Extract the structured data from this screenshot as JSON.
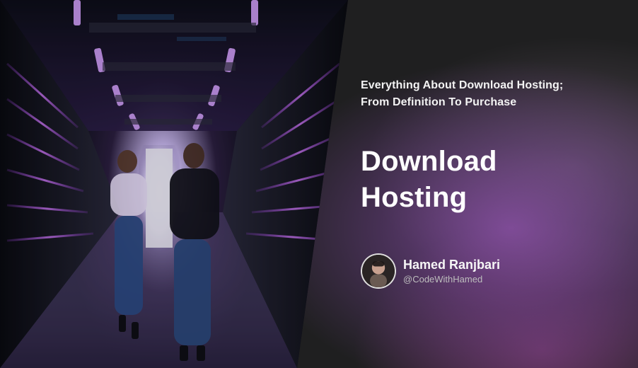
{
  "header": {
    "subtitle": "Everything About Download Hosting;\nFrom Definition To Purchase",
    "title": "Download\nHosting"
  },
  "author": {
    "name": "Hamed Ranjbari",
    "handle": "@CodeWithHamed"
  },
  "colors": {
    "background": "#1f1f20",
    "accent_glow": "#9654b6",
    "text_primary": "#ffffff",
    "text_secondary": "#bdbdbd"
  },
  "images": {
    "hero": "server-room-corridor-illustration",
    "avatar": "author-avatar"
  }
}
